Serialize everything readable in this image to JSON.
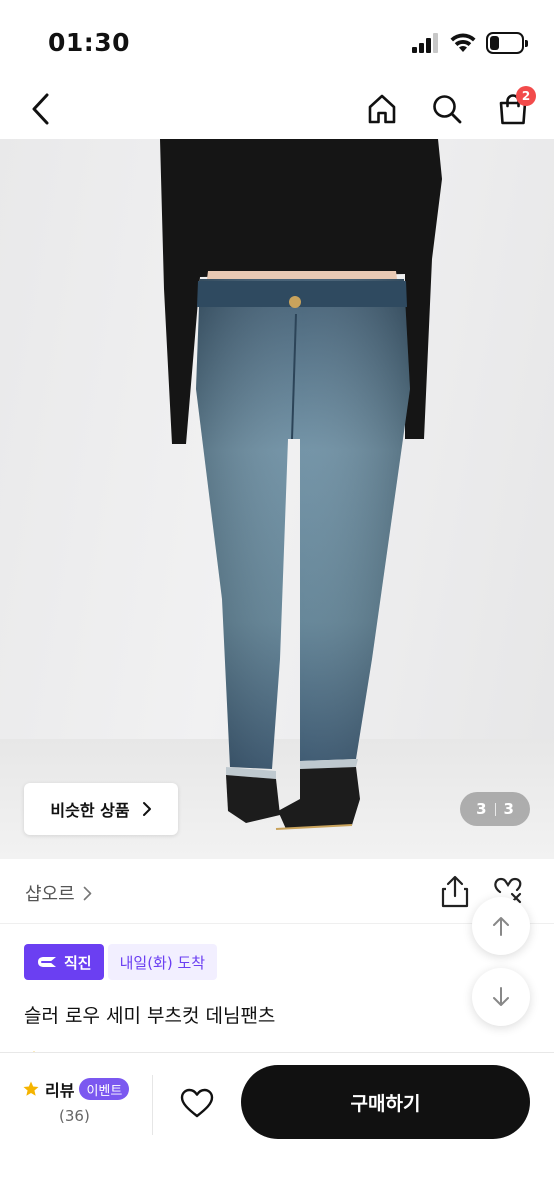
{
  "status_bar": {
    "time": "01:30",
    "icons": [
      "signal-icon",
      "wifi-icon",
      "battery-icon"
    ],
    "battery_level": 0.3
  },
  "nav": {
    "icons": [
      "back-icon",
      "home-icon",
      "search-icon",
      "shopping-bag-icon"
    ],
    "cart_count": "2"
  },
  "gallery": {
    "similar_label": "비슷한 상품",
    "current_page": "3",
    "total_pages": "3"
  },
  "shop": {
    "name": "샵오르",
    "icons": [
      "share-icon",
      "dislike-icon"
    ]
  },
  "tags": {
    "direct": "직진",
    "delivery": "내일(화) 도착"
  },
  "product": {
    "title": "슬러 로우 세미 부츠컷 데님팬츠"
  },
  "scroll": {
    "icons": [
      "arrow-up-icon",
      "arrow-down-icon"
    ]
  },
  "bottom_bar": {
    "review_label": "리뷰",
    "event_label": "이벤트",
    "review_count": "(36)",
    "buy_label": "구매하기"
  },
  "colors": {
    "accent": "#6b3ff2",
    "event": "#7b58f0",
    "badge": "#f24b4b",
    "button": "#111111"
  }
}
